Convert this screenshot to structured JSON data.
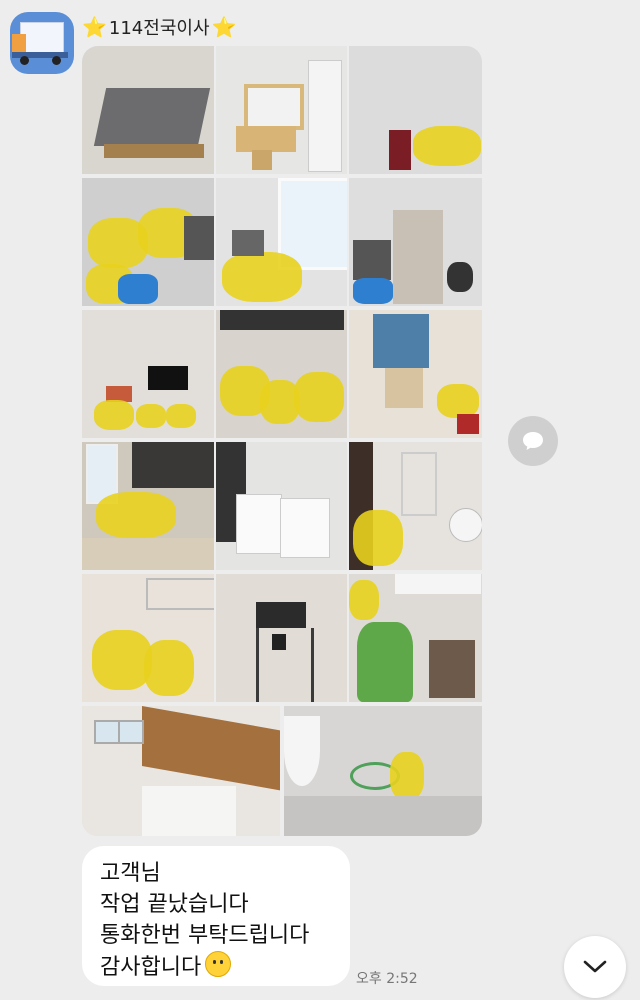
{
  "chat": {
    "sender_name": "114전국이사",
    "sender_star_left": "⭐",
    "sender_star_right": "⭐",
    "avatar_icon": "moving-truck-icon",
    "photo_count": 17,
    "message_lines": [
      "고객님",
      "작업 끝났습니다",
      "통화한번 부탁드립니다",
      "감사합니다"
    ],
    "message_emoji": "smiling-face-icon",
    "timestamp": "오후 2:52"
  },
  "controls": {
    "share_icon": "speech-bubble-icon",
    "scroll_icon": "chevron-down-icon"
  },
  "colors": {
    "background": "#ededed",
    "bubble": "#ffffff",
    "bag_yellow": "#e8d21e",
    "bag_blue": "#2f7fd1"
  }
}
